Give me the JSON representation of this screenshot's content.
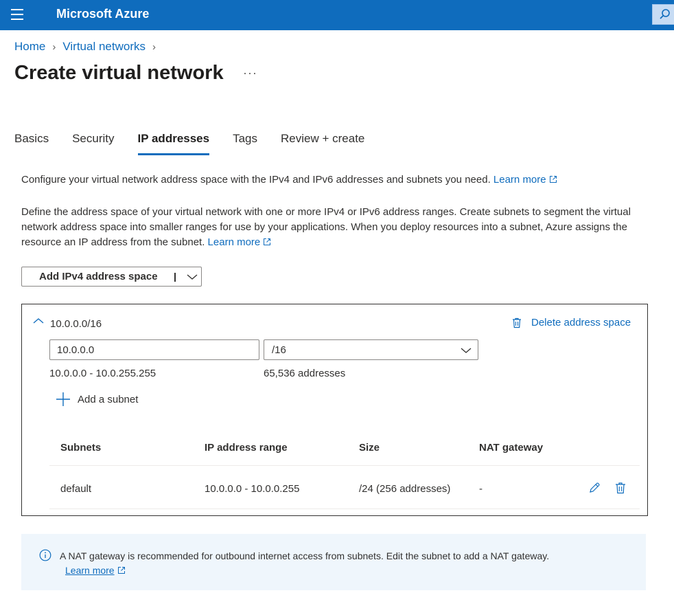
{
  "topbar": {
    "brand": "Microsoft Azure"
  },
  "breadcrumb": {
    "home": "Home",
    "virtual_networks": "Virtual networks"
  },
  "page": {
    "title": "Create virtual network",
    "more": "···"
  },
  "tabs": [
    {
      "label": "Basics"
    },
    {
      "label": "Security"
    },
    {
      "label": "IP addresses"
    },
    {
      "label": "Tags"
    },
    {
      "label": "Review + create"
    }
  ],
  "intro": {
    "text": "Configure your virtual network address space with the IPv4 and IPv6 addresses and subnets you need.",
    "learn_more": "Learn more"
  },
  "description": {
    "text": "Define the address space of your virtual network with one or more IPv4 or IPv6 address ranges. Create subnets to segment the virtual network address space into smaller ranges for use by your applications. When you deploy resources into a subnet, Azure assigns the resource an IP address from the subnet.",
    "learn_more": "Learn more"
  },
  "add_space": {
    "label": "Add IPv4 address space"
  },
  "address_space": {
    "name": "10.0.0.0/16",
    "delete_label": "Delete address space",
    "address_value": "10.0.0.0",
    "prefix_value": "/16",
    "range": "10.0.0.0 - 10.0.255.255",
    "count": "65,536 addresses",
    "add_subnet_label": "Add a subnet"
  },
  "subnet_table": {
    "headers": [
      "Subnets",
      "IP address range",
      "Size",
      "NAT gateway"
    ],
    "rows": [
      {
        "name": "default",
        "range": "10.0.0.0 - 10.0.0.255",
        "size": "/24 (256 addresses)",
        "nat": "-"
      }
    ]
  },
  "info_bar": {
    "text": "A NAT gateway is recommended for outbound internet access from subnets. Edit the subnet to add a NAT gateway.",
    "learn_more": "Learn more"
  },
  "colors": {
    "brand_blue": "#0f6cbd",
    "info_bg": "#eff6fc"
  }
}
